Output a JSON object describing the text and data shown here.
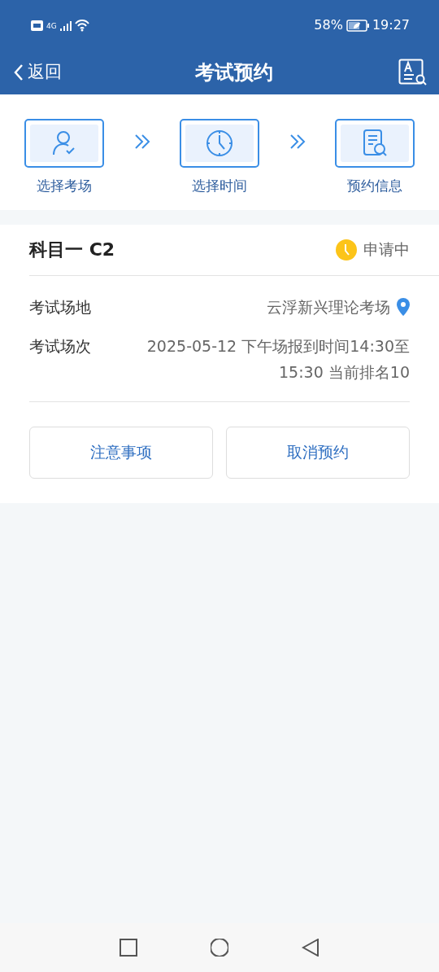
{
  "status_bar": {
    "network": "4G",
    "battery": "58%",
    "time": "19:27"
  },
  "header": {
    "back": "返回",
    "title": "考试预约"
  },
  "steps": [
    {
      "kind": "person",
      "label": "选择考场"
    },
    {
      "kind": "clock",
      "label": "选择时间"
    },
    {
      "kind": "document",
      "label": "预约信息"
    }
  ],
  "card": {
    "subject": "科目一 C2",
    "status": "申请中",
    "fields": [
      {
        "label": "考试场地",
        "value": "云浮新兴理论考场",
        "kind": "location"
      },
      {
        "label": "考试场次",
        "value": "2025-05-12 下午场报到时间14:30至15:30 当前排名10",
        "kind": "text"
      }
    ],
    "buttons": [
      "注意事项",
      "取消预约"
    ]
  }
}
